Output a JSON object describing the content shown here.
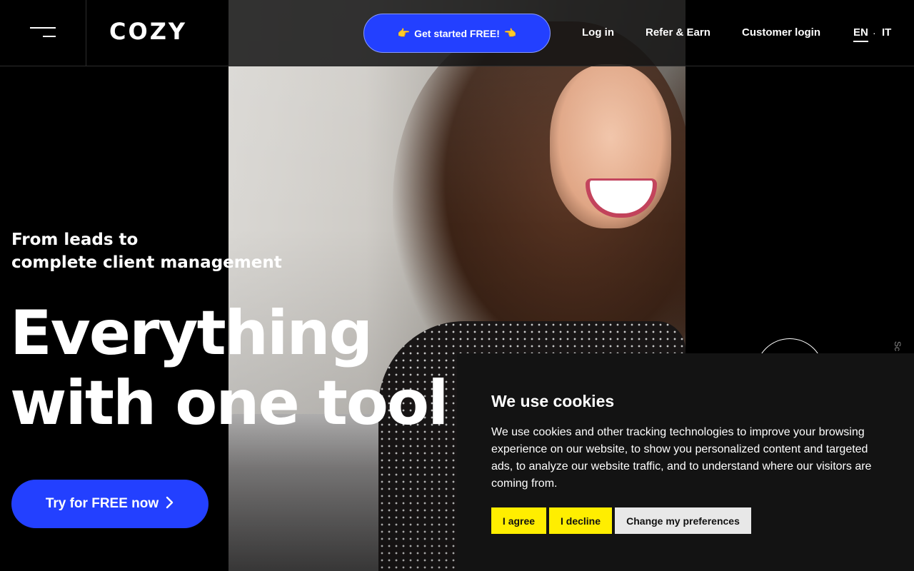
{
  "header": {
    "logo": "COZY",
    "cta": {
      "label": "Get started FREE!",
      "icon_left": "👉",
      "icon_right": "👈"
    },
    "nav": {
      "login": "Log in",
      "refer": "Refer & Earn",
      "customer_login": "Customer login"
    },
    "languages": {
      "en": "EN",
      "separator": "·",
      "it": "IT",
      "active": "EN"
    }
  },
  "hero": {
    "subtitle_line1": "From leads to",
    "subtitle_line2": "complete client management",
    "title_line1": "Everything",
    "title_line2": "with one tool",
    "cta_label": "Try for FREE now",
    "cta_icon": "chevron-right-icon",
    "scroll_label": "Sc"
  },
  "cookie_banner": {
    "title": "We use cookies",
    "text": "We use cookies and other tracking technologies to improve your browsing experience on our website, to show you personalized content and targeted ads, to analyze our website traffic, and to understand where our visitors are coming from.",
    "agree_label": "I agree",
    "decline_label": "I decline",
    "preferences_label": "Change my preferences"
  },
  "colors": {
    "accent": "#2340ff",
    "cookie_button": "#ffee00",
    "background": "#000000"
  }
}
